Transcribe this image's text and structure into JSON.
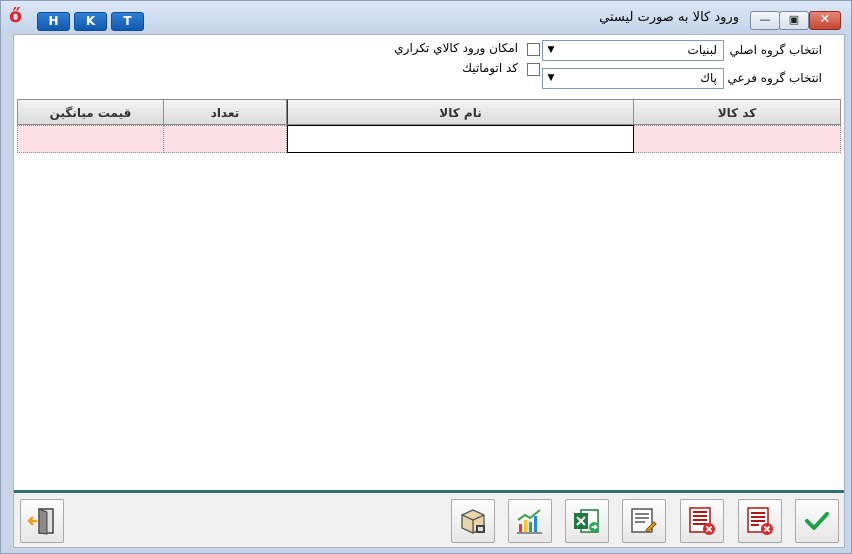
{
  "window": {
    "title": "ورود كالا به صورت ليستي",
    "logo_glyph": "ő",
    "buttons": {
      "minimize": "—",
      "restore": "▣",
      "close": "✕"
    },
    "hk_buttons": [
      "H",
      "K",
      "T"
    ]
  },
  "filters": {
    "main_group_label": "انتخاب گروه اصلي",
    "main_group_value": "لبنيات",
    "sub_group_label": "انتخاب گروه فرعي",
    "sub_group_value": "پاك",
    "duplicate_label": "امكان ورود كالاي تكراري",
    "auto_code_label": "كد اتوماتيك",
    "arrow": "▼"
  },
  "grid": {
    "columns": [
      "كد كالا",
      "نام كالا",
      "تعداد",
      "قيمت ميانگين"
    ]
  },
  "colors": {
    "accent": "#1259ad",
    "separator": "#2f6f6f",
    "pink_cell": "#fbe0e6"
  },
  "toolbar": {
    "icons": [
      "confirm-check-icon",
      "delete-list-icon",
      "delete-all-icon",
      "edit-list-icon",
      "excel-export-icon",
      "chart-icon",
      "package-icon",
      "exit-icon"
    ]
  }
}
